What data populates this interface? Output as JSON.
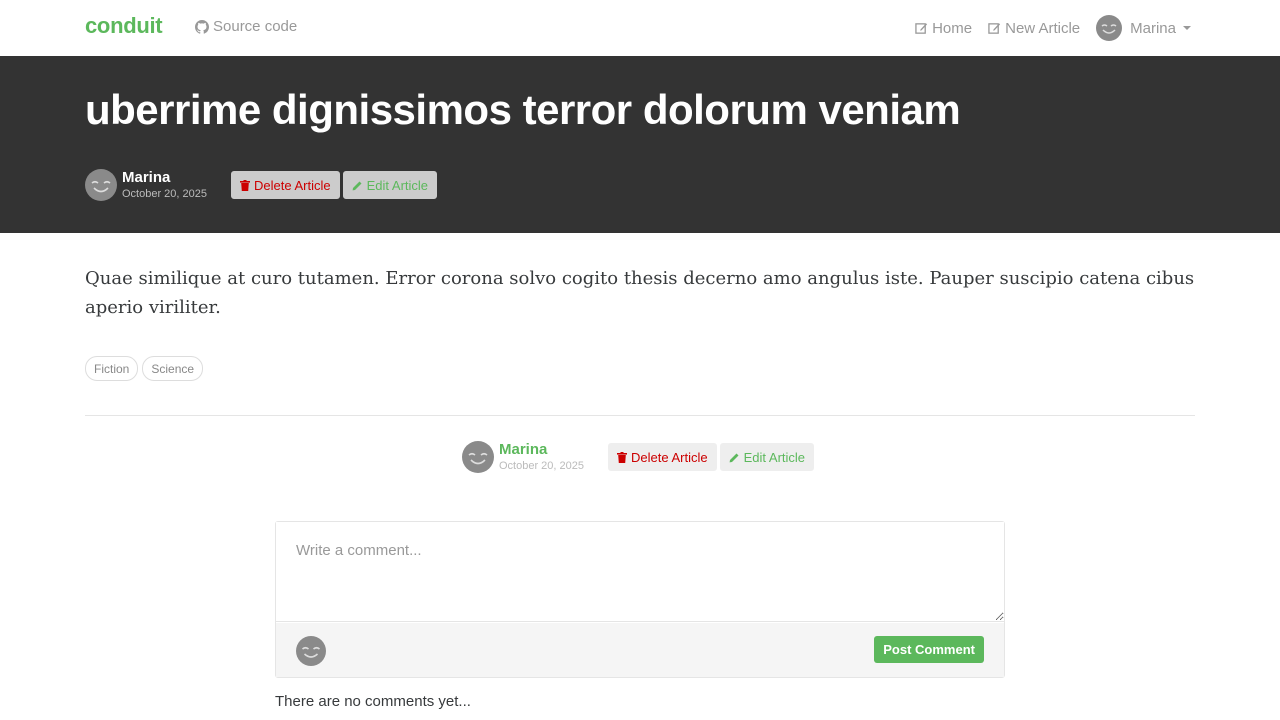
{
  "navbar": {
    "brand": "conduit",
    "source_code": "Source code",
    "home": "Home",
    "new_article": "New Article",
    "user": "Marina",
    "icons": {
      "source": "github-icon",
      "home": "edit-icon",
      "new_article": "edit-icon"
    }
  },
  "article": {
    "title": "uberrime dignissimos terror dolorum veniam",
    "author": "Marina",
    "date": "October 20, 2025",
    "delete_label": "Delete Article",
    "edit_label": "Edit Article",
    "body": "Quae similique at curo tutamen. Error corona solvo cogito thesis decerno amo angulus iste. Pauper suscipio catena cibus aperio viriliter.",
    "tags": [
      "Fiction",
      "Science"
    ]
  },
  "comment_form": {
    "placeholder": "Write a comment...",
    "submit_label": "Post Comment"
  },
  "comments": {
    "empty_text": "There are no comments yet..."
  },
  "colors": {
    "brand": "#5cb85c",
    "banner_bg": "#333333",
    "danger": "#cc0000"
  }
}
